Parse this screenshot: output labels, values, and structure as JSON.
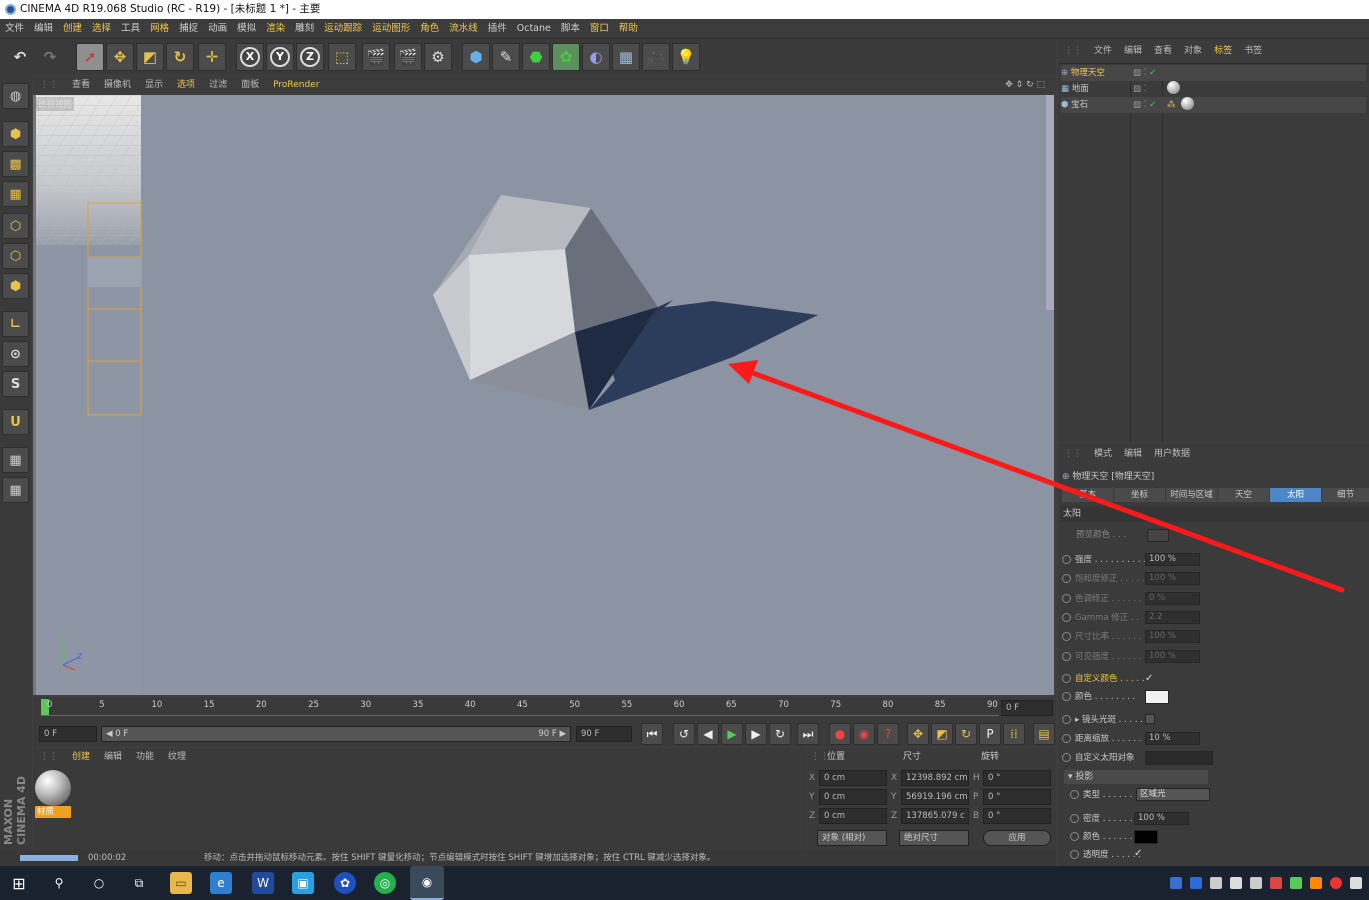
{
  "window": {
    "title": "CINEMA 4D R19.068 Studio (RC - R19) - [未标题 1 *] - 主要"
  },
  "menu": [
    "文件",
    "编辑",
    "创建",
    "选择",
    "工具",
    "网格",
    "捕捉",
    "动画",
    "模拟",
    "渲染",
    "雕刻",
    "运动跟踪",
    "运动图形",
    "角色",
    "流水线",
    "插件",
    "Octane",
    "脚本",
    "窗口",
    "帮助"
  ],
  "viewport": {
    "menu": [
      "查看",
      "摄像机",
      "显示",
      "选项",
      "过滤",
      "面板",
      "ProRender"
    ],
    "label": "透视视图",
    "axes": {
      "y": "Y",
      "z": "Z"
    }
  },
  "timeline": {
    "ticks": [
      "0",
      "5",
      "10",
      "15",
      "20",
      "25",
      "30",
      "35",
      "40",
      "45",
      "50",
      "55",
      "60",
      "65",
      "70",
      "75",
      "80",
      "85",
      "90"
    ],
    "current_frame": "0 F",
    "start": "0 F",
    "range_start": "◀ 0 F",
    "range_end": "90 F ▶",
    "end": "90 F"
  },
  "materials": {
    "menu": [
      "创建",
      "编辑",
      "功能",
      "纹理"
    ],
    "items": [
      {
        "name": "材质"
      }
    ]
  },
  "coords": {
    "headers": {
      "pos": "位置",
      "size": "尺寸",
      "rot": "旋转"
    },
    "rows": [
      {
        "axis": "X",
        "pos": "0 cm",
        "size_axis": "X",
        "size": "12398.892 cm",
        "rot_axis": "H",
        "rot": "0 °"
      },
      {
        "axis": "Y",
        "pos": "0 cm",
        "size_axis": "Y",
        "size": "56919.196 cm",
        "rot_axis": "P",
        "rot": "0 °"
      },
      {
        "axis": "Z",
        "pos": "0 cm",
        "size_axis": "Z",
        "size": "137865.079 c",
        "rot_axis": "B",
        "rot": "0 °"
      }
    ],
    "mode": "对象 (相对)",
    "size_mode": "绝对尺寸",
    "apply": "应用"
  },
  "status": {
    "time": "00:00:02",
    "message": "移动：点击并拖动鼠标移动元素。按住 SHIFT 键量化移动；节点编辑模式时按住 SHIFT 键增加选择对象；按住 CTRL 键减少选择对象。"
  },
  "objects": {
    "menu": [
      "文件",
      "编辑",
      "查看",
      "对象",
      "标签",
      "书签"
    ],
    "items": [
      {
        "name": "物理天空",
        "color": "#f0c850"
      },
      {
        "name": "地面",
        "color": "#c8c8c8"
      },
      {
        "name": "宝石",
        "color": "#c8c8c8"
      }
    ]
  },
  "attributes": {
    "menu": [
      "模式",
      "编辑",
      "用户数据"
    ],
    "object_title": "物理天空 [物理天空]",
    "tabs": [
      "基本",
      "坐标",
      "时间与区域",
      "天空",
      "太阳",
      "细节"
    ],
    "active_tab": "太阳",
    "section": "太阳",
    "preview_color_label": "预览颜色 . . .",
    "params": [
      {
        "label": "强度 . . . . . . . . . . .",
        "value": "100 %",
        "enabled": true
      },
      {
        "label": "饱和度修正 . . . . . .",
        "value": "100 %",
        "enabled": false
      },
      {
        "label": "色调修正 . . . . . . . .",
        "value": "0 %",
        "enabled": false
      },
      {
        "label": "Gamma 修正 . .",
        "value": "2.2",
        "enabled": false
      },
      {
        "label": "尺寸比率 . . . . . . . .",
        "value": "100 %",
        "enabled": false
      },
      {
        "label": "可见强度 . . . . . . . .",
        "value": "100 %",
        "enabled": false
      }
    ],
    "custom_color_label": "自定义颜色 . . . . .",
    "color_label": "颜色 . . . . . . . .",
    "lens_flare_label": "▸ 镜头光斑 . . . . . .",
    "distance_scale_label": "距离缩放 . . . . . . . .",
    "distance_scale_value": "10 %",
    "custom_sun_label": "自定义太阳对象",
    "shadow_section": "▾ 投影",
    "shadow_type_label": "类型 . . . . . . . .",
    "shadow_type_value": "区域光",
    "density_label": "密度 . . . . . . .",
    "density_value": "100 %",
    "shadow_color_label": "颜色 . . . . . . .",
    "transparency_label": "透明度 . . . . . ."
  },
  "maxon_logo": "MAXON CINEMA 4D",
  "colors": {
    "accent": "#f0c850",
    "active_tab": "#4d87c6",
    "arrow": "#ff1a1a",
    "viewport_bg": "#8c93a2",
    "shadow": "#2c3d5c"
  }
}
